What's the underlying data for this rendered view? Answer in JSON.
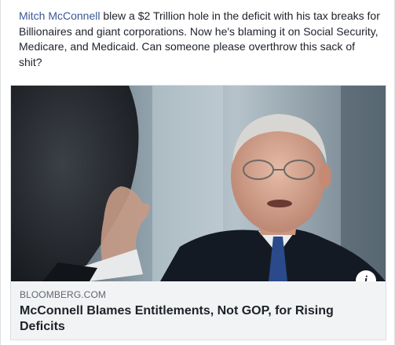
{
  "post": {
    "mention": "Mitch McConnell",
    "text": " blew a $2 Trillion hole in the deficit with his tax breaks for Billionaires and giant corporations. Now he's blaming it on Social Security, Medicare, and Medicaid. Can someone please overthrow this sack of shit?"
  },
  "link_card": {
    "domain": "BLOOMBERG.COM",
    "title": "McConnell Blames Entitlements, Not GOP, for Rising Deficits",
    "info_icon": "i"
  },
  "colors": {
    "link_blue": "#385898",
    "text": "#1d2129",
    "muted": "#606770",
    "card_bg": "#f2f3f5"
  }
}
